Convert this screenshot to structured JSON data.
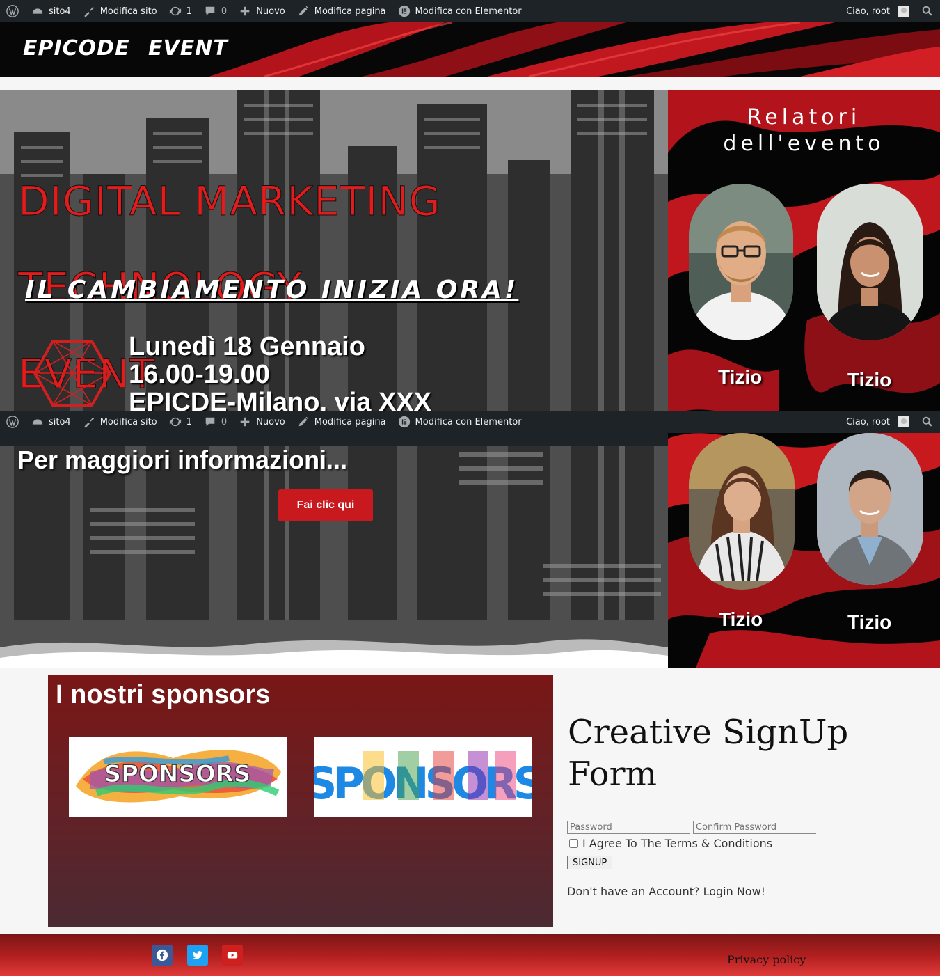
{
  "admin_bar": {
    "site_name": "sito4",
    "customize": "Modifica sito",
    "updates_count": "1",
    "comments_count": "0",
    "new": "Nuovo",
    "edit_page": "Modifica pagina",
    "edit_elementor": "Modifica con Elementor",
    "greeting": "Ciao, root"
  },
  "header": {
    "nav": [
      "EPICODE",
      "EVENT"
    ]
  },
  "hero": {
    "title_lines": [
      "DIGITAL MARKETING",
      "TECHNOLOGY",
      "EVENT"
    ],
    "tagline": "IL CAMBIAMENTO INIZIA ORA!",
    "date": "Lunedì 18 Gennaio",
    "time": "16.00-19.00",
    "location": "EPICDE-Milano, via XXX",
    "more_info": "Per maggiori informazioni...",
    "cta_label": "Fai clic qui"
  },
  "speakers": {
    "title": "Relatori\ndell'evento",
    "items": [
      {
        "name": "Tizio"
      },
      {
        "name": "Tizio"
      },
      {
        "name": "Tizio"
      },
      {
        "name": "Tizio"
      }
    ]
  },
  "sponsors": {
    "heading": "I nostri sponsors",
    "logos": [
      "SPONSORS",
      "SPONSORS"
    ]
  },
  "signup": {
    "title": "Creative SignUp Form",
    "password_placeholder": "Password",
    "confirm_placeholder": "Confirm Password",
    "agree_label": "I Agree To The Terms & Conditions",
    "button_label": "SIGNUP",
    "login_text": "Don't have an Account? Login Now!"
  },
  "footer": {
    "privacy": "Privacy policy",
    "social_icons": [
      "facebook-icon",
      "twitter-icon",
      "youtube-icon"
    ]
  },
  "colors": {
    "accent_red": "#c8191f",
    "admin_bar": "#1d2327",
    "facebook": "#3b5998",
    "twitter": "#1da1f2",
    "youtube": "#cd201f"
  }
}
